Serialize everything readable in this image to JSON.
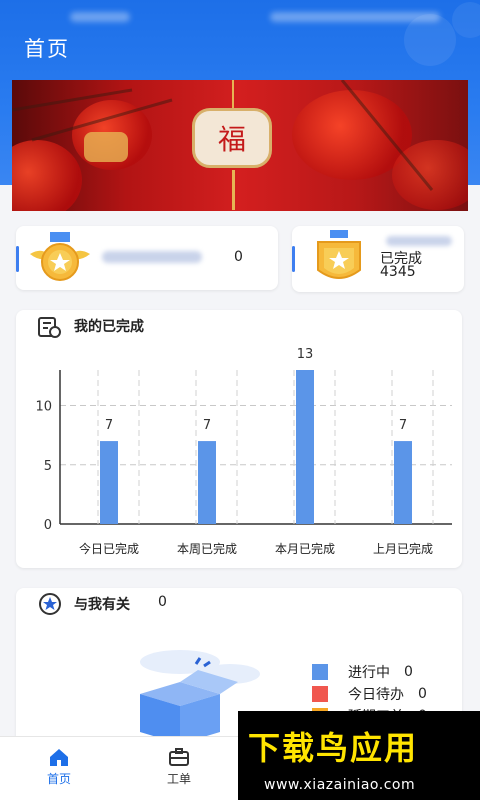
{
  "header": {
    "title": "首页",
    "bg_color": "#1d6fe8"
  },
  "banner": {
    "charm_text": "福"
  },
  "stats": {
    "left": {
      "value": "0"
    },
    "right": {
      "label": "已完成",
      "value": "4345"
    }
  },
  "chart_card": {
    "title": "我的已完成"
  },
  "chart_data": {
    "type": "bar",
    "categories": [
      "今日已完成",
      "本周已完成",
      "本月已完成",
      "上月已完成"
    ],
    "values": [
      7,
      7,
      13,
      7
    ],
    "value_labels": [
      "7",
      "7",
      "13",
      "7"
    ],
    "ylim": [
      0,
      13
    ],
    "yticks": [
      "0",
      "5",
      "10"
    ],
    "grid": true,
    "bar_color": "#5b95e8"
  },
  "related": {
    "title": "与我有关",
    "count": "0",
    "legend": [
      {
        "label": "进行中",
        "value": "0",
        "color": "#5b95e8"
      },
      {
        "label": "今日待办",
        "value": "0",
        "color": "#f0574f"
      },
      {
        "label": "延期工单",
        "value": "0",
        "color": "#f5a623"
      }
    ]
  },
  "tabbar": {
    "items": [
      {
        "label": "首页",
        "active": true,
        "icon": "home-icon"
      },
      {
        "label": "工单",
        "active": false,
        "icon": "briefcase-icon"
      }
    ],
    "active_color": "#1d6fe8"
  },
  "watermark": {
    "title": "下载鸟应用",
    "url": "www.xiazainiao.com"
  }
}
